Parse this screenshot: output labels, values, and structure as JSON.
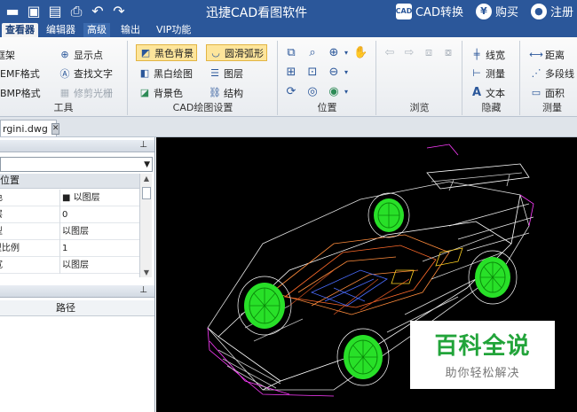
{
  "app": {
    "title": "迅捷CAD看图软件",
    "cad_convert": "CAD转换",
    "buy": "购买",
    "register": "注册",
    "cad_badge": "CAD",
    "buy_symbol": "¥"
  },
  "tabs": [
    "查看器",
    "编辑器",
    "高级",
    "输出",
    "VIP功能"
  ],
  "ribbon": {
    "tools": {
      "label": "工具",
      "items": [
        "框架",
        "存为EMF格式",
        "存为BMP格式",
        "显示点",
        "查找文字",
        "修剪光栅"
      ]
    },
    "cad_settings": {
      "label": "CAD绘图设置",
      "items": [
        "黑色背景",
        "黑白绘图",
        "背景色",
        "圆滑弧形",
        "图层",
        "结构"
      ]
    },
    "position": {
      "label": "位置"
    },
    "browse": {
      "label": "浏览"
    },
    "hide": {
      "label": "隐藏",
      "items": [
        "线宽",
        "测量",
        "文本"
      ]
    },
    "measure": {
      "label": "测量",
      "items": [
        "距离",
        "多段线",
        "面积"
      ]
    }
  },
  "document": {
    "tab_name": "Lamborgini.dwg",
    "tab_visible": "rgini.dwg",
    "close": "✕"
  },
  "properties": {
    "header": "位置",
    "rows": [
      {
        "key": "颜色",
        "value": "■ 以图层"
      },
      {
        "key": "图层",
        "value": "0"
      },
      {
        "key": "线型",
        "value": "以图层"
      },
      {
        "key": "线型比例",
        "value": "1"
      },
      {
        "key": "线宽",
        "value": "以图层"
      }
    ]
  },
  "list": {
    "column": "路径"
  },
  "watermark": {
    "main": "百科全说",
    "sub": "助你轻松解决"
  },
  "colors": {
    "titlebar": "#2b579a",
    "accent_selected": "#fde59b",
    "wheel": "#28e028",
    "canvas": "#000000"
  }
}
